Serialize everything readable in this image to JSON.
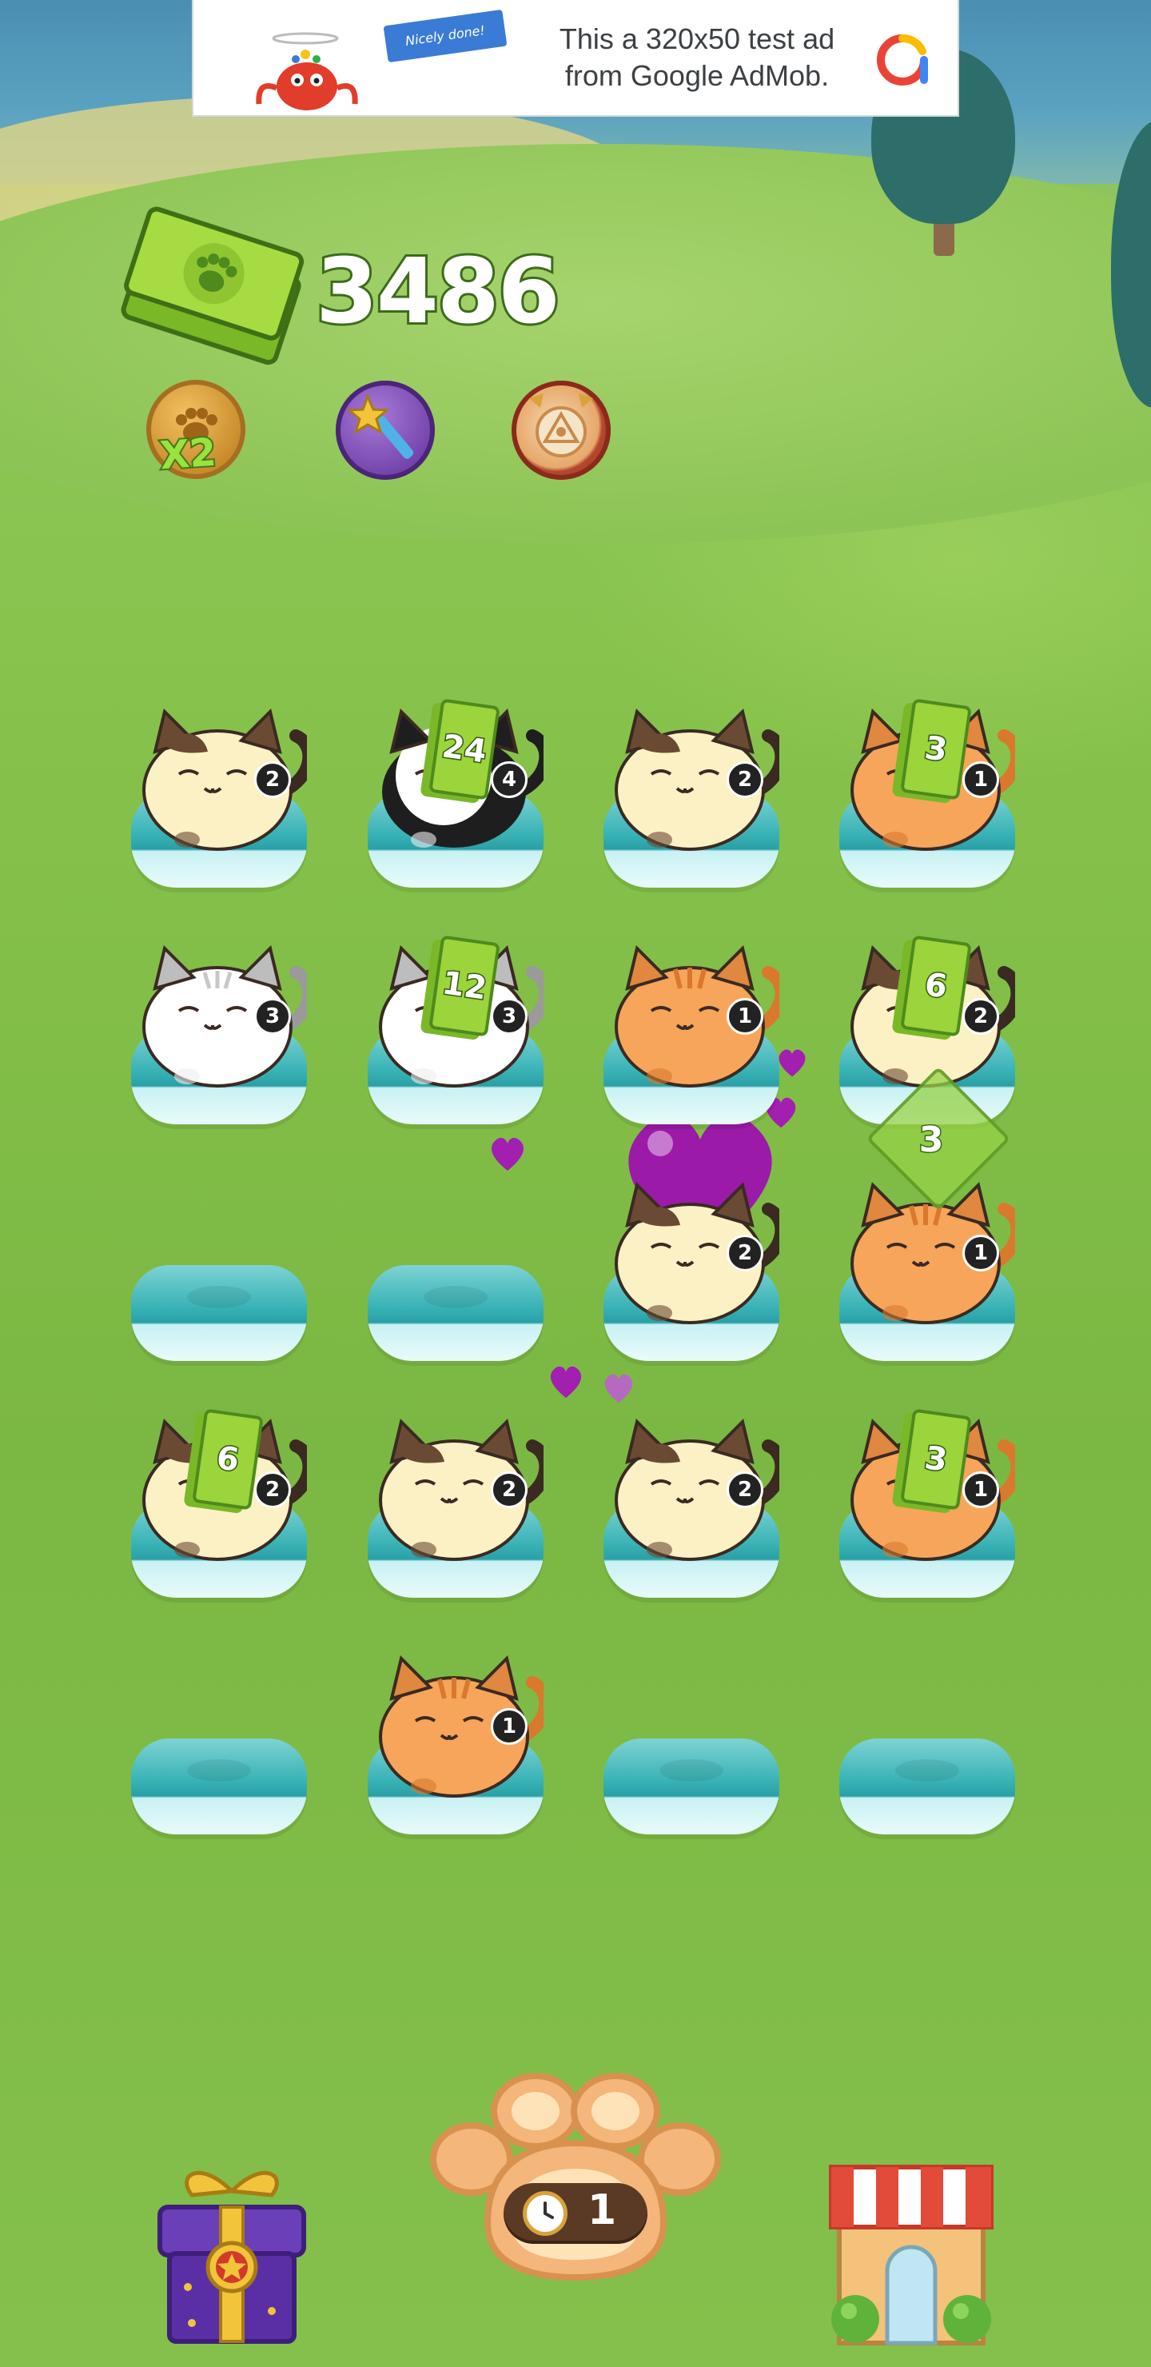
{
  "ad": {
    "line1": "This a 320x50 test ad",
    "line2": "from Google AdMob.",
    "flag_text": "Nicely done!"
  },
  "currency": {
    "icon": "cash-paw-icon",
    "value": "3486"
  },
  "boosters": [
    {
      "name": "coin-multiplier",
      "icon": "paw-coin-icon",
      "label": "X2"
    },
    {
      "name": "magic-wand",
      "icon": "wand-icon"
    },
    {
      "name": "auto-merge-clock",
      "icon": "cat-clock-icon"
    }
  ],
  "board": {
    "rows": 5,
    "cols": 4,
    "cells": [
      [
        {
          "cat": "calico",
          "level": "2"
        },
        {
          "cat": "panda",
          "level": "4",
          "earning": "24"
        },
        {
          "cat": "calico",
          "level": "2"
        },
        {
          "cat": "orange",
          "level": "1",
          "earning": "3"
        }
      ],
      [
        {
          "cat": "white",
          "level": "3"
        },
        {
          "cat": "white",
          "level": "3",
          "earning": "12"
        },
        {
          "cat": "orange",
          "level": "1"
        },
        {
          "cat": "calico",
          "level": "2",
          "earning": "6"
        }
      ],
      [
        {
          "cat": "empty"
        },
        {
          "cat": "empty"
        },
        {
          "cat": "calico",
          "level": "2"
        },
        {
          "cat": "orange",
          "level": "1"
        }
      ],
      [
        {
          "cat": "calico",
          "level": "2",
          "earning": "6"
        },
        {
          "cat": "calico",
          "level": "2"
        },
        {
          "cat": "calico",
          "level": "2"
        },
        {
          "cat": "orange",
          "level": "1",
          "earning": "3"
        }
      ],
      [
        {
          "cat": "empty"
        },
        {
          "cat": "orange",
          "level": "1"
        },
        {
          "cat": "empty"
        },
        {
          "cat": "empty"
        }
      ]
    ],
    "floating_earning": "3"
  },
  "bottom_bar": {
    "gift_icon": "gift-box-icon",
    "spawn_icon": "paw-spawn-icon",
    "timer_value": "1",
    "shop_icon": "shop-icon"
  },
  "colors": {
    "grass": "#86c24b",
    "pad": "#38b2b5",
    "cash": "#9bd43b",
    "heart": "#9b1aa8"
  }
}
